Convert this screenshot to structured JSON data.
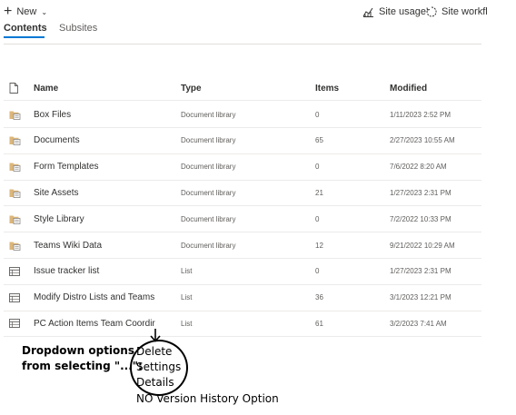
{
  "commandbar": {
    "new_label": "New",
    "site_usage_label": "Site usage",
    "site_workflows_label": "Site workfl"
  },
  "tabs": [
    {
      "label": "Contents",
      "selected": true
    },
    {
      "label": "Subsites",
      "selected": false
    }
  ],
  "table": {
    "headers": {
      "name": "Name",
      "type": "Type",
      "items": "Items",
      "modified": "Modified"
    },
    "rows": [
      {
        "icon": "library-icon",
        "name": "Box Files",
        "type": "Document library",
        "items": "0",
        "modified": "1/11/2023 2:52 PM"
      },
      {
        "icon": "library-icon",
        "name": "Documents",
        "type": "Document library",
        "items": "65",
        "modified": "2/27/2023 10:55 AM"
      },
      {
        "icon": "library-icon",
        "name": "Form Templates",
        "type": "Document library",
        "items": "0",
        "modified": "7/6/2022 8:20 AM"
      },
      {
        "icon": "library-icon",
        "name": "Site Assets",
        "type": "Document library",
        "items": "21",
        "modified": "1/27/2023 2:31 PM"
      },
      {
        "icon": "library-icon",
        "name": "Style Library",
        "type": "Document library",
        "items": "0",
        "modified": "7/2/2022 10:33 PM"
      },
      {
        "icon": "library-icon",
        "name": "Teams Wiki Data",
        "type": "Document library",
        "items": "12",
        "modified": "9/21/2022 10:29 AM"
      },
      {
        "icon": "list-icon",
        "name": "Issue tracker list",
        "type": "List",
        "items": "0",
        "modified": "1/27/2023 2:31 PM"
      },
      {
        "icon": "list-icon",
        "name": "Modify Distro Lists and Teams",
        "type": "List",
        "items": "36",
        "modified": "3/1/2023 12:21 PM"
      },
      {
        "icon": "list-icon",
        "name": "PC Action Items Team Coordir",
        "type": "List",
        "items": "61",
        "modified": "3/2/2023 7:41 AM"
      }
    ]
  },
  "annotation": {
    "label_line1": "Dropdown options",
    "label_line2": "from selecting \"...\":",
    "dropdown_options": [
      "Delete",
      "Settings",
      "Details"
    ],
    "note": "NO Version History Option"
  },
  "colors": {
    "accent": "#0078d4",
    "folder": "#dcb67a"
  }
}
